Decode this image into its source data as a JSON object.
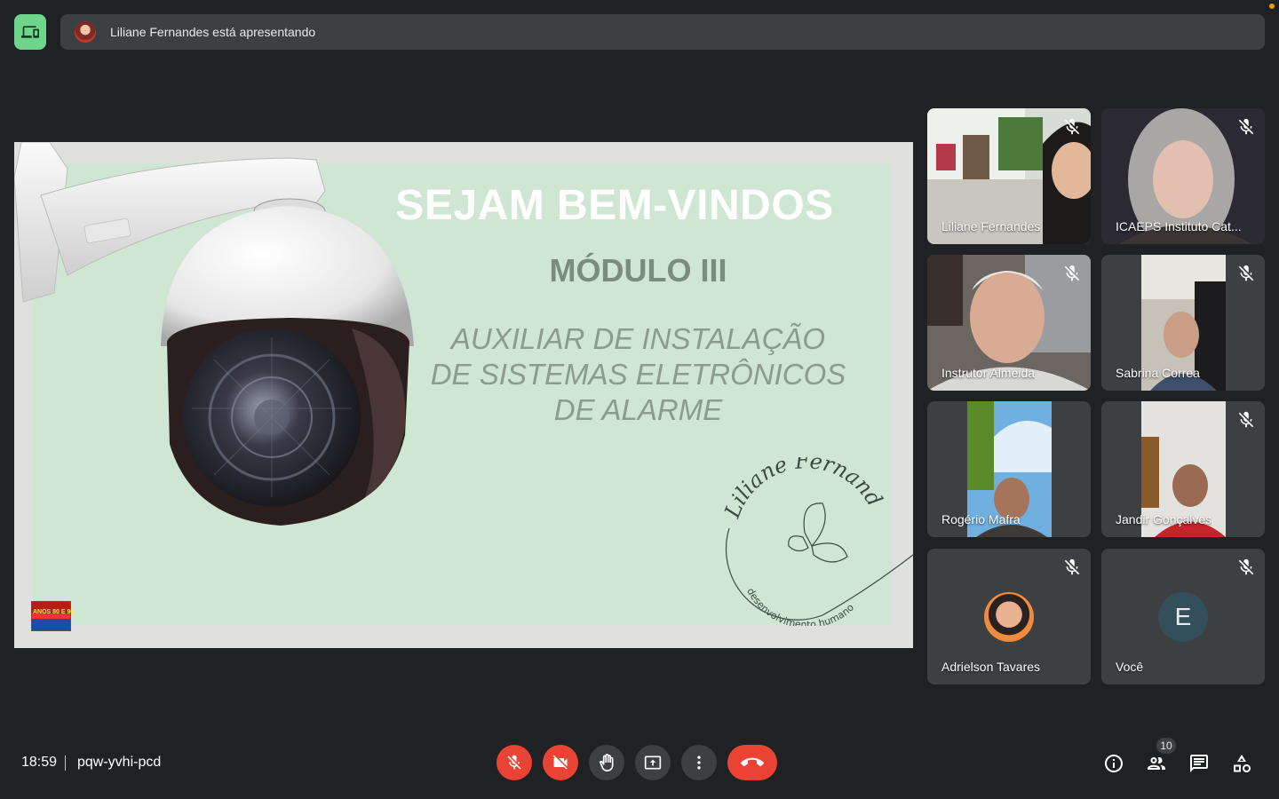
{
  "header": {
    "presenting_text": "Liliane Fernandes está apresentando"
  },
  "slide": {
    "title": "SEJAM BEM-VINDOS",
    "module": "MÓDULO III",
    "course_lines": [
      "AUXILIAR DE INSTALAÇÃO",
      "DE SISTEMAS ELETRÔNICOS",
      "DE ALARME"
    ],
    "logo_name": "Liliane Fernandes",
    "logo_tagline": "desenvolvimento humano"
  },
  "participants": [
    {
      "name": "Liliane Fernandes",
      "muted": true
    },
    {
      "name": "ICAEPS Instituto Cat...",
      "muted": true
    },
    {
      "name": "Instrutor Almeida",
      "muted": true
    },
    {
      "name": "Sabrina Correa",
      "muted": true
    },
    {
      "name": "Rogério Mafra",
      "muted": false
    },
    {
      "name": "Jandir Gonçalves",
      "muted": true
    },
    {
      "name": "Adrielson Tavares",
      "muted": true
    },
    {
      "name": "Você",
      "muted": true,
      "initial": "E"
    }
  ],
  "footer": {
    "time": "18:59",
    "meeting_code": "pqw-yvhi-pcd",
    "participants_count": "10"
  },
  "colors": {
    "background": "#202124",
    "danger": "#ea4335",
    "device_button": "#6dd58c",
    "tile": "#3c4043"
  }
}
